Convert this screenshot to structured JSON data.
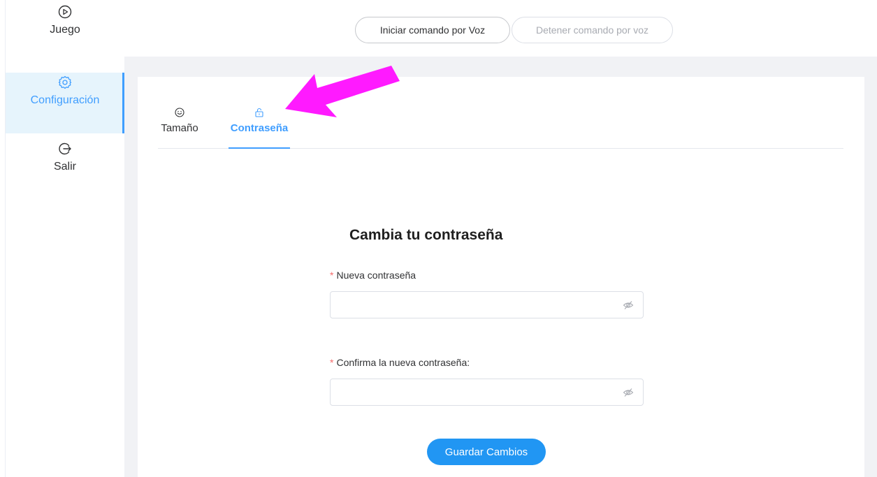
{
  "sidebar": {
    "items": [
      {
        "label": "Juego",
        "icon": "play-circle-icon"
      },
      {
        "label": "Configuración",
        "icon": "gear-icon"
      },
      {
        "label": "Salir",
        "icon": "logout-icon"
      }
    ]
  },
  "topbar": {
    "start_voice_label": "Iniciar comando por Voz",
    "stop_voice_label": "Detener comando por voz"
  },
  "tabs": [
    {
      "label": "Tamaño",
      "icon": "smile-icon"
    },
    {
      "label": "Contraseña",
      "icon": "unlock-icon"
    }
  ],
  "form": {
    "title": "Cambia tu contraseña",
    "new_password_label": "Nueva contraseña",
    "confirm_password_label": "Confirma la nueva contraseña:",
    "required_mark": "*",
    "save_label": "Guardar Cambios"
  },
  "colors": {
    "accent": "#409eff",
    "save_button": "#2196f3",
    "annotation_arrow": "#ff1aff"
  }
}
